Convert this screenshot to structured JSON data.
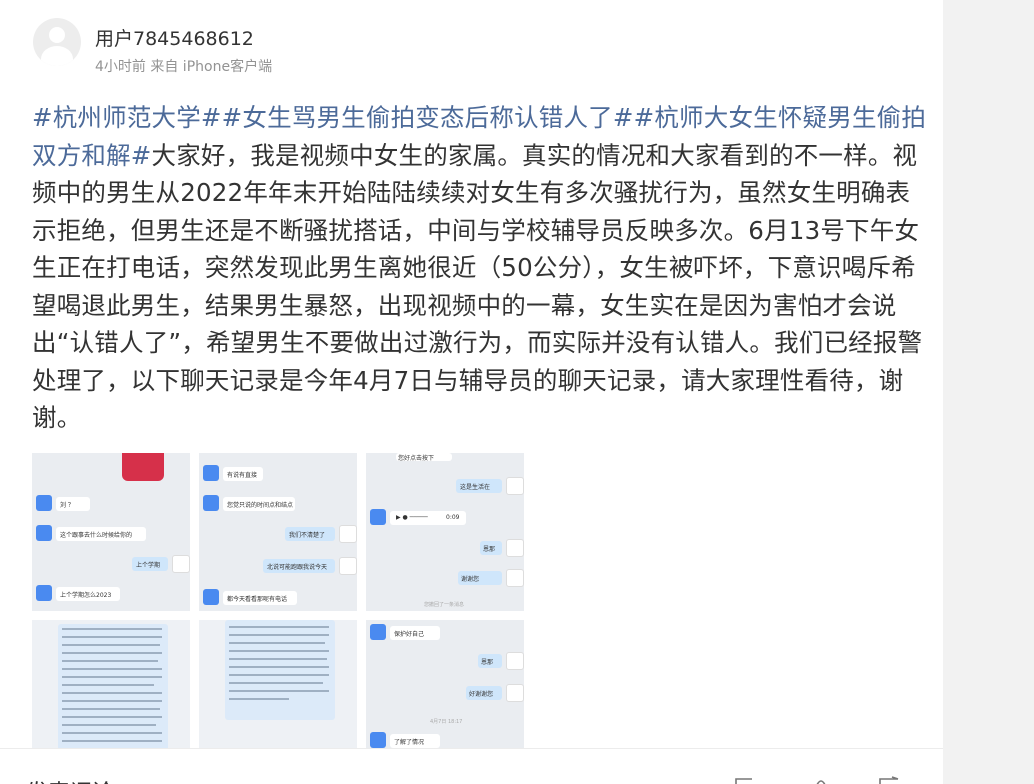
{
  "post": {
    "username": "用户7845468612",
    "meta": "4小时前 来自 iPhone客户端",
    "hashtags": [
      "#杭州师范大学#",
      "#女生骂男生偷拍变态后称认错人了#",
      "#杭师大女生怀疑男生偷拍双方和解#"
    ],
    "body": "大家好，我是视频中女生的家属。真实的情况和大家看到的不一样。视频中的男生从2022年年末开始陆陆续续对女生有多次骚扰行为，虽然女生明确表示拒绝，但男生还是不断骚扰搭话，中间与学校辅导员反映多次。6月13号下午女生正在打电话，突然发现此男生离她很近（50公分），女生被吓坏，下意识喝斥希望喝退此男生，结果男生暴怒，出现视频中的一幕，女生实在是因为害怕才会说出“认错人了”，希望男生不要做出过激行为，而实际并没有认错人。我们已经报警处理了，以下聊天记录是今年4月7日与辅导员的聊天记录，请大家理性看待，谢谢。"
  },
  "images": {
    "img1": {
      "m1": "刘  ？",
      "m2": "这个跟事去什么时候给你的",
      "m3": "上个学期",
      "m4": "上个学期怎么2023"
    },
    "img2": {
      "m1": "有说有直接",
      "m2": "您觉只说的时间点和结点",
      "m3": "我们不清楚了",
      "m4": "北说可能跑跟我说今天",
      "m5": "都今天看看那呢有电话"
    },
    "img3": {
      "m1": "您好点击按下",
      "m2": "这是生活在",
      "audio": "0:09",
      "m3": "恩那",
      "m4": "谢谢您",
      "m5": "您撤回了一条消息"
    },
    "img6": {
      "m1": "保护好自己",
      "m2": "恩那",
      "m3": "好谢谢您",
      "m4": "4月7日 18:17",
      "m5": "了解了情况"
    }
  },
  "footer": {
    "comment_label": "发表评论"
  }
}
